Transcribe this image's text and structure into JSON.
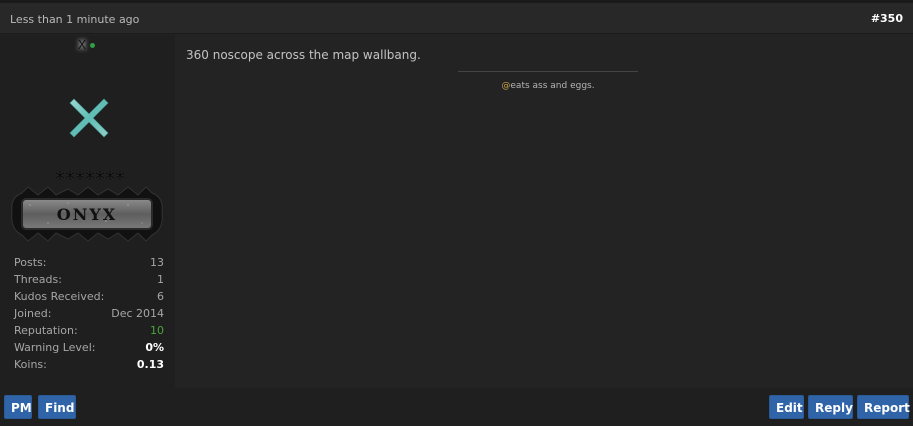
{
  "post": {
    "time": "Less than 1 minute ago",
    "number": "#350",
    "message": "360 noscope across the map wallbang.",
    "signature_at": "@",
    "signature_text": "eats ass and eggs."
  },
  "user": {
    "name": "X",
    "rank_stars": "*******",
    "rank_name": "ONYX",
    "stats": [
      {
        "label": "Posts:",
        "value": "13"
      },
      {
        "label": "Threads:",
        "value": "1"
      },
      {
        "label": "Kudos Received:",
        "value": "6"
      },
      {
        "label": "Joined:",
        "value": "Dec 2014"
      },
      {
        "label": "Reputation:",
        "value": "10"
      },
      {
        "label": "Warning Level:",
        "value": "0%"
      },
      {
        "label": "Koins:",
        "value": "0.13"
      }
    ]
  },
  "buttons": {
    "pm": "PM",
    "find": "Find",
    "edit": "Edit",
    "reply": "Reply",
    "report": "Report"
  },
  "colors": {
    "button_blue": "#2f65a8",
    "reputation_green": "#4aa53c",
    "background": "#232323"
  }
}
